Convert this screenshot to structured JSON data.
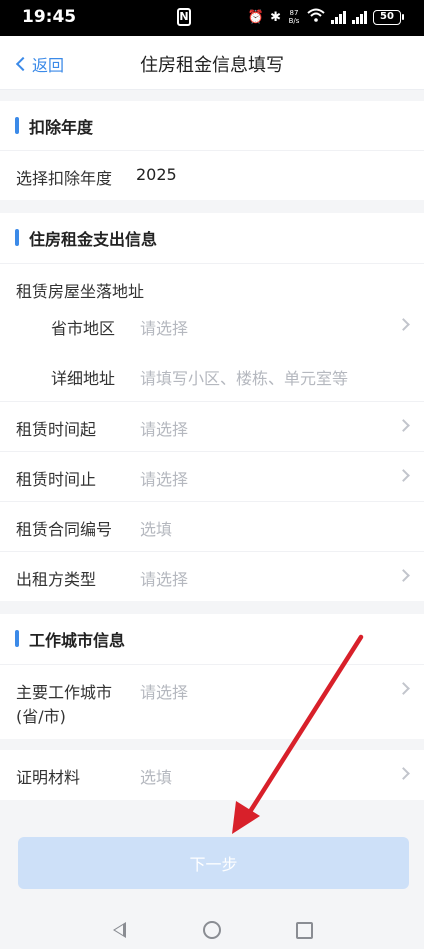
{
  "status": {
    "time": "19:45",
    "nfc": "N",
    "net_speed_value": "87",
    "net_speed_unit": "B/s",
    "battery": "50"
  },
  "nav": {
    "back_label": "返回",
    "title": "住房租金信息填写"
  },
  "deduction_year": {
    "title": "扣除年度",
    "label": "选择扣除年度",
    "value": "2025"
  },
  "rent_expense": {
    "title": "住房租金支出信息",
    "address_label": "租赁房屋坐落地址",
    "province_label": "省市地区",
    "province_placeholder": "请选择",
    "detail_label": "详细地址",
    "detail_placeholder": "请填写小区、楼栋、单元室等",
    "start_label": "租赁时间起",
    "start_placeholder": "请选择",
    "end_label": "租赁时间止",
    "end_placeholder": "请选择",
    "contract_label": "租赁合同编号",
    "contract_placeholder": "选填",
    "landlord_label": "出租方类型",
    "landlord_placeholder": "请选择"
  },
  "work_city": {
    "title": "工作城市信息",
    "city_label_line1": "主要工作城市",
    "city_label_line2": "(省/市)",
    "city_placeholder": "请选择"
  },
  "proof": {
    "label": "证明材料",
    "placeholder": "选填"
  },
  "next_button": "下一步",
  "colors": {
    "accent": "#3b8ae8",
    "button_disabled": "#cde0f8",
    "annotation_arrow": "#d8202a"
  }
}
